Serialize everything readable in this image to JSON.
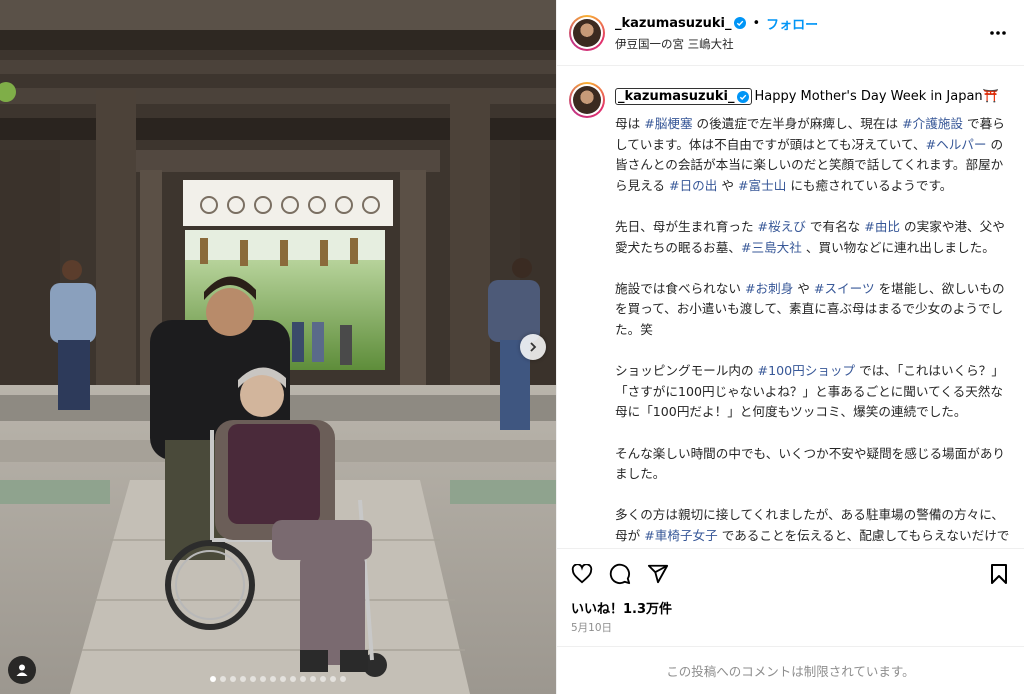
{
  "header": {
    "username": "_kazumasuzuki_",
    "bullet": "•",
    "follow_label": "フォロー",
    "location": "伊豆国一の宮 三嶋大社"
  },
  "caption": {
    "username": "_kazumasuzuki_",
    "title": "Happy Mother's Day Week in Japan⛩️",
    "paragraphs": [
      [
        "母は ",
        {
          "tag": "#脳梗塞"
        },
        " の後遺症で左半身が麻痺し、現在は ",
        {
          "tag": "#介護施設"
        },
        " で暮らしています。体は不自由ですが頭はとても冴えていて、",
        {
          "tag": "#ヘルパー"
        },
        " の皆さんとの会話が本当に楽しいのだと笑顔で話してくれます。部屋から見える ",
        {
          "tag": "#日の出"
        },
        " や ",
        {
          "tag": "#富士山"
        },
        " にも癒されているようです。"
      ],
      [
        "先日、母が生まれ育った ",
        {
          "tag": "#桜えび"
        },
        " で有名な ",
        {
          "tag": "#由比"
        },
        " の実家や港、父や愛犬たちの眠るお墓、",
        {
          "tag": "#三島大社"
        },
        " 、買い物などに連れ出しました。"
      ],
      [
        "施設では食べられない ",
        {
          "tag": "#お刺身"
        },
        " や ",
        {
          "tag": "#スイーツ"
        },
        " を堪能し、欲しいものを買って、お小遣いも渡して、素直に喜ぶ母はまるで少女のようでした。笑"
      ],
      [
        "ショッピングモール内の ",
        {
          "tag": "#100円ショップ"
        },
        " では、「これはいくら？」「さすがに100円じゃないよね？」と事あるごとに聞いてくる天然な母に「100円だよ！」と何度もツッコミ、爆笑の連続でした。"
      ],
      [
        "そんな楽しい時間の中でも、いくつか不安や疑問を感じる場面がありました。"
      ],
      [
        "多くの方は親切に接してくれましたが、ある駐車場の警備の方々に、母が ",
        {
          "tag": "#車椅子女子"
        },
        " であることを伝えると、配慮してもらえないだけでなく面倒がられて、とても悲しい気持ちになりました。"
      ]
    ]
  },
  "stats": {
    "likes": "いいね！1.3万件",
    "date": "5月10日"
  },
  "footer": {
    "comments_disabled": "この投稿へのコメントは制限されています。"
  },
  "carousel": {
    "total_dots": 14,
    "active_index": 0
  },
  "icons": {
    "verified": "verified-badge-icon",
    "more": "more-horizontal-icon",
    "like": "heart-icon",
    "comment": "comment-icon",
    "share": "share-icon",
    "save": "bookmark-icon",
    "next": "chevron-right-icon",
    "tags": "user-tag-icon"
  },
  "colors": {
    "link": "#0095f6",
    "hashtag": "#385898",
    "muted": "#8e8e8e",
    "verified": "#0095f6"
  }
}
